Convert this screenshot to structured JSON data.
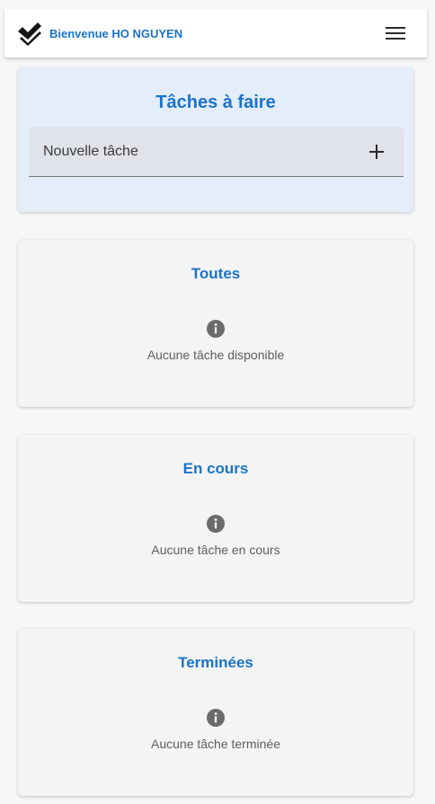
{
  "header": {
    "welcome": "Bienvenue HO NGUYEN",
    "logo_icon": "double-check-icon",
    "menu_icon": "hamburger-menu-icon"
  },
  "todo": {
    "title": "Tâches à faire",
    "input_placeholder": "Nouvelle tâche",
    "input_value": "",
    "add_icon": "plus-icon"
  },
  "sections": {
    "all": {
      "title": "Toutes",
      "empty": "Aucune tâche disponible",
      "icon": "info-icon"
    },
    "in_progress": {
      "title": "En cours",
      "empty": "Aucune tâche en cours",
      "icon": "info-icon"
    },
    "done": {
      "title": "Terminées",
      "empty": "Aucune tâche terminée",
      "icon": "info-icon"
    }
  },
  "colors": {
    "accent": "#1a73c8",
    "page_bg": "#f7f7f7",
    "todo_card_bg": "#e4edfa",
    "list_card_bg": "#f4f4f4",
    "info_icon": "#6b6b6b"
  }
}
